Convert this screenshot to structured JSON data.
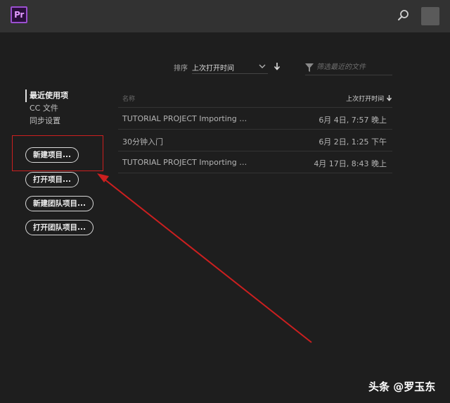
{
  "app": {
    "logo_text": "Pr",
    "accent_color": "#9b4fd0"
  },
  "topbar": {
    "search_icon": "search-icon",
    "avatar": "user-avatar"
  },
  "sort": {
    "label": "排序",
    "selected": "上次打开时间",
    "dropdown_icon": "chevron-down-icon",
    "direction_icon": "arrow-down-icon"
  },
  "filter": {
    "icon": "funnel-icon",
    "placeholder": "筛选最近的文件"
  },
  "sidebar": {
    "items": [
      {
        "label": "最近使用项",
        "active": true
      },
      {
        "label": "CC 文件",
        "active": false
      },
      {
        "label": "同步设置",
        "active": false
      }
    ]
  },
  "actions": {
    "new_project": "新建项目...",
    "open_project": "打开项目...",
    "new_team_project": "新建团队项目...",
    "open_team_project": "打开团队项目..."
  },
  "table": {
    "columns": {
      "name": "名称",
      "date": "上次打开时间"
    },
    "rows": [
      {
        "name": "TUTORIAL PROJECT Importing Media",
        "date": "6月 4日, 7:57 晚上"
      },
      {
        "name": "30分钟入门",
        "date": "6月 2日, 1:25 下午"
      },
      {
        "name": "TUTORIAL PROJECT Importing Media",
        "date": "4月 17日, 8:43 晚上"
      }
    ]
  },
  "annotation": {
    "color": "#cc1f1f"
  },
  "watermark": "头条 @罗玉东"
}
